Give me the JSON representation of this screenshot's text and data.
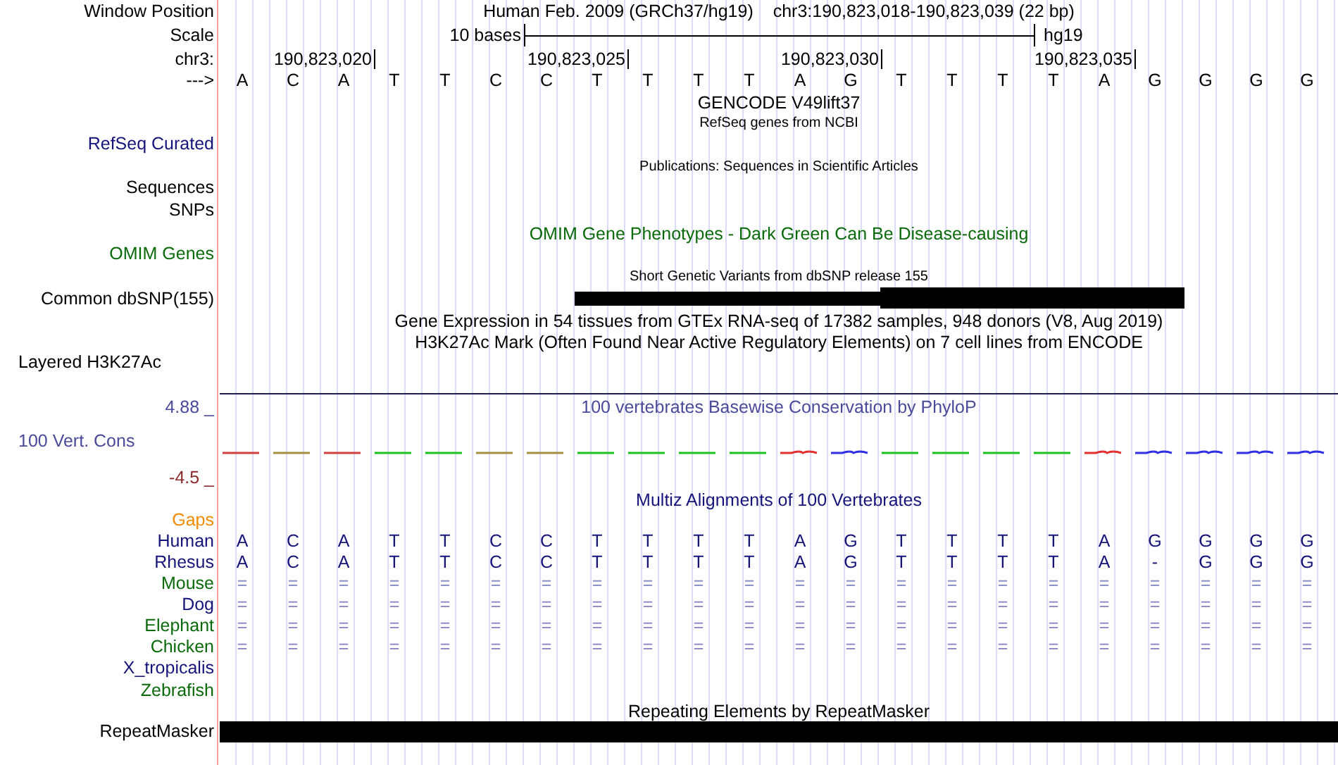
{
  "position": {
    "label": "Window Position",
    "assembly": "Human Feb. 2009 (GRCh37/hg19)",
    "range": "chr3:190,823,018-190,823,039 (22 bp)"
  },
  "scale": {
    "label": "Scale",
    "span": "10 bases",
    "assembly": "hg19"
  },
  "ruler": {
    "label": "chr3:",
    "ticks": [
      "190,823,020",
      "190,823,025",
      "190,823,030",
      "190,823,035"
    ]
  },
  "sequence": {
    "label": "--->",
    "bases": [
      "A",
      "C",
      "A",
      "T",
      "T",
      "C",
      "C",
      "T",
      "T",
      "T",
      "T",
      "A",
      "G",
      "T",
      "T",
      "T",
      "T",
      "A",
      "G",
      "G",
      "G",
      "G"
    ]
  },
  "track_titles": [
    {
      "text": "GENCODE V49lift37",
      "kind": "normal",
      "color": "#000000"
    },
    {
      "text": "RefSeq genes from NCBI",
      "kind": "small",
      "color": "#000000"
    },
    {
      "text": "Publications: Sequences in Scientific Articles",
      "kind": "small",
      "color": "#000000"
    },
    {
      "text": "OMIM Gene Phenotypes - Dark Green Can Be Disease-causing",
      "kind": "normal",
      "color": "#0a6a0a"
    },
    {
      "text": "Short Genetic Variants from dbSNP release 155",
      "kind": "small",
      "color": "#000000"
    },
    {
      "text": "Gene Expression in 54 tissues from GTEx RNA-seq of 17382 samples, 948 donors (V8, Aug 2019)",
      "kind": "normal",
      "color": "#000000"
    },
    {
      "text": "H3K27Ac Mark (Often Found Near Active Regulatory Elements) on 7 cell lines from ENCODE",
      "kind": "normal",
      "color": "#000000"
    },
    {
      "text": "100 vertebrates Basewise Conservation by PhyloP",
      "kind": "normal",
      "color": "#4a4a9a"
    },
    {
      "text": "Multiz Alignments of 100 Vertebrates",
      "kind": "normal",
      "color": "#14147a"
    },
    {
      "text": "Repeating Elements by RepeatMasker",
      "kind": "normal",
      "color": "#000000"
    }
  ],
  "track_labels": [
    {
      "text": "RefSeq Curated",
      "color": "#14147a"
    },
    {
      "text": "Sequences",
      "color": "#000000"
    },
    {
      "text": "SNPs",
      "color": "#000000"
    },
    {
      "text": "OMIM Genes",
      "color": "#0a6a0a"
    },
    {
      "text": "Common dbSNP(155)",
      "color": "#000000"
    },
    {
      "text": "Layered H3K27Ac",
      "color": "#000000"
    },
    {
      "text": "4.88 _",
      "color": "#4a4a9a"
    },
    {
      "text": "100 Vert. Cons",
      "color": "#4a4a9a"
    },
    {
      "text": "-4.5 _",
      "color": "#8a2a2a"
    },
    {
      "text": "RepeatMasker",
      "color": "#000000"
    }
  ],
  "alignment": [
    {
      "name": "Gaps",
      "color": "#f08c00",
      "kind": "gaps"
    },
    {
      "name": "Human",
      "color": "#14147a",
      "kind": "sequence",
      "bases": [
        "A",
        "C",
        "A",
        "T",
        "T",
        "C",
        "C",
        "T",
        "T",
        "T",
        "T",
        "A",
        "G",
        "T",
        "T",
        "T",
        "T",
        "A",
        "G",
        "G",
        "G",
        "G"
      ]
    },
    {
      "name": "Rhesus",
      "color": "#14147a",
      "kind": "sequence",
      "bases": [
        "A",
        "C",
        "A",
        "T",
        "T",
        "C",
        "C",
        "T",
        "T",
        "T",
        "T",
        "A",
        "G",
        "T",
        "T",
        "T",
        "T",
        "A",
        "-",
        "G",
        "G",
        "G"
      ]
    },
    {
      "name": "Mouse",
      "color": "#0a6a0a",
      "kind": "match",
      "bases": [
        "=",
        "=",
        "=",
        "=",
        "=",
        "=",
        "=",
        "=",
        "=",
        "=",
        "=",
        "=",
        "=",
        "=",
        "=",
        "=",
        "=",
        "=",
        "=",
        "=",
        "=",
        "="
      ]
    },
    {
      "name": "Dog",
      "color": "#14147a",
      "kind": "match",
      "bases": [
        "=",
        "=",
        "=",
        "=",
        "=",
        "=",
        "=",
        "=",
        "=",
        "=",
        "=",
        "=",
        "=",
        "=",
        "=",
        "=",
        "=",
        "=",
        "=",
        "=",
        "=",
        "="
      ]
    },
    {
      "name": "Elephant",
      "color": "#0a6a0a",
      "kind": "match",
      "bases": [
        "=",
        "=",
        "=",
        "=",
        "=",
        "=",
        "=",
        "=",
        "=",
        "=",
        "=",
        "=",
        "=",
        "=",
        "=",
        "=",
        "=",
        "=",
        "=",
        "=",
        "=",
        "="
      ]
    },
    {
      "name": "Chicken",
      "color": "#0a6a0a",
      "kind": "match",
      "bases": [
        "=",
        "=",
        "=",
        "=",
        "=",
        "=",
        "=",
        "=",
        "=",
        "=",
        "=",
        "=",
        "=",
        "=",
        "=",
        "=",
        "=",
        "=",
        "=",
        "=",
        "=",
        "="
      ]
    },
    {
      "name": "X_tropicalis",
      "color": "#14147a",
      "kind": "empty"
    },
    {
      "name": "Zebrafish",
      "color": "#0a6a0a",
      "kind": "empty"
    }
  ]
}
